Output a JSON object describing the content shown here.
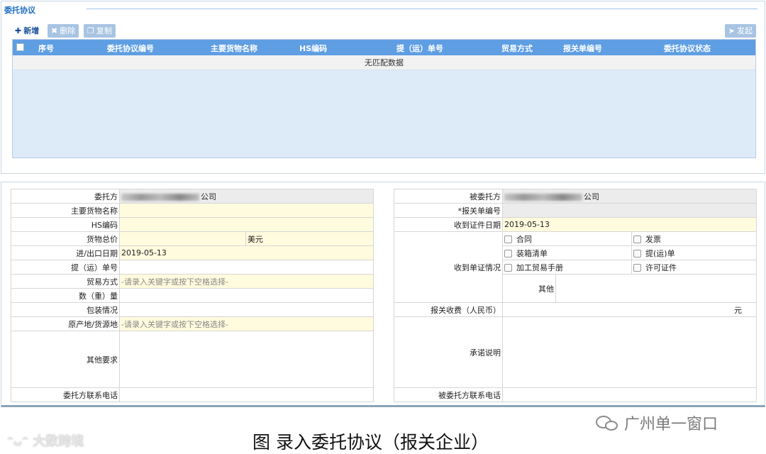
{
  "panel": {
    "title": "委托协议"
  },
  "toolbar": {
    "add": "新增",
    "delete": "删除",
    "copy": "复制",
    "send": "发起"
  },
  "grid": {
    "columns": [
      "序号",
      "委托协议编号",
      "主要货物名称",
      "HS编码",
      "提（运）单号",
      "贸易方式",
      "报关单编号",
      "委托协议状态"
    ],
    "empty_text": "无匹配数据"
  },
  "left_form": {
    "client": {
      "label": "委托方",
      "value_suffix": "公司"
    },
    "goods_name": {
      "label": "主要货物名称",
      "value": ""
    },
    "hs_code": {
      "label": "HS编码",
      "value": ""
    },
    "total_price": {
      "label": "货物总价",
      "value": "",
      "currency": "美元"
    },
    "ie_date": {
      "label": "进/出口日期",
      "value": "2019-05-13"
    },
    "bill_no": {
      "label": "提（运）单号",
      "value": ""
    },
    "trade_mode": {
      "label": "贸易方式",
      "placeholder": "-请录入关键字或按下空格选择-"
    },
    "quantity": {
      "label": "数（重）量",
      "value": ""
    },
    "packing": {
      "label": "包装情况",
      "value": ""
    },
    "origin": {
      "label": "原产地/货源地",
      "placeholder": "-请录入关键字或按下空格选择-"
    },
    "other_req": {
      "label": "其他要求",
      "value": ""
    },
    "phone": {
      "label": "委托方联系电话",
      "value": ""
    }
  },
  "right_form": {
    "agent": {
      "label": "被委托方",
      "value_suffix": "公司"
    },
    "decl_no": {
      "label": "*报关单编号",
      "value": ""
    },
    "doc_date": {
      "label": "收到证件日期",
      "value": "2019-05-13"
    },
    "docs": {
      "label": "收到单证情况",
      "items": [
        "合同",
        "发票",
        "装箱清单",
        "提(运)单",
        "加工贸易手册",
        "许可证件"
      ],
      "other_label": "其他"
    },
    "fee": {
      "label": "报关收费（人民币）",
      "unit": "元"
    },
    "promise": {
      "label": "承诺说明",
      "value": ""
    },
    "phone": {
      "label": "被委托方联系电话",
      "value": ""
    }
  },
  "footer": {
    "watermark_left": "大数跨境",
    "caption": "图  录入委托协议（报关企业）",
    "watermark_right": "广州单一窗口"
  }
}
